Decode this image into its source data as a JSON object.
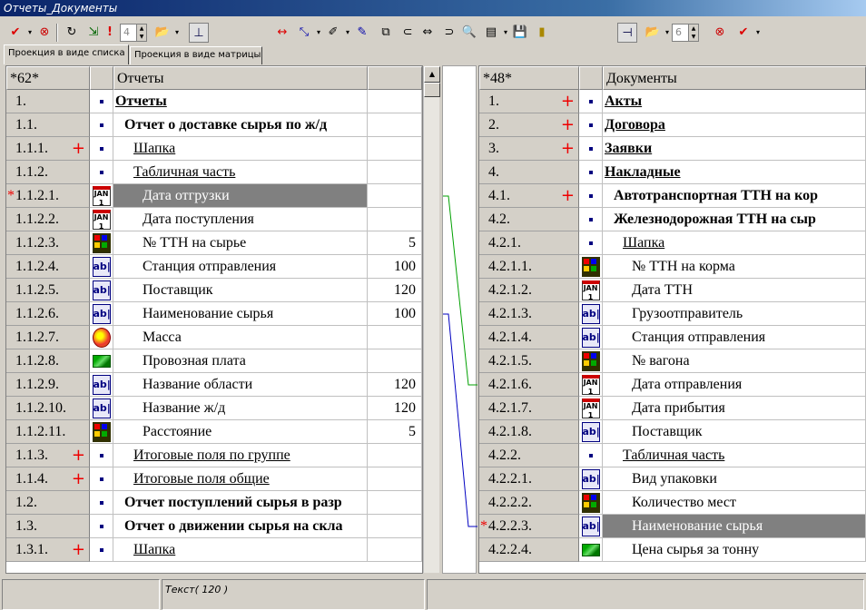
{
  "window": {
    "title": "Отчеты_Документы"
  },
  "toolbar": {
    "left_spin_value": "4",
    "right_spin_value": "6",
    "icons": [
      "check-icon",
      "cancel-icon",
      "refresh-icon",
      "add-link-icon",
      "exclamation-icon",
      "folder-open-icon",
      "tree-view-icon",
      "horizontal-arrows-icon",
      "connect-icon",
      "eraser-icon",
      "wand-icon",
      "copy-icon",
      "link-left-icon",
      "link-both-icon",
      "link-right-icon",
      "preview-icon",
      "export-icon",
      "save-icon",
      "exit-icon",
      "layout-icon"
    ]
  },
  "tabs": [
    {
      "label": "Проекция в виде списка",
      "active": true
    },
    {
      "label": "Проекция в виде матрицы",
      "active": false
    }
  ],
  "left_panel": {
    "header": {
      "num": "*62*",
      "name": "Отчеты",
      "value": ""
    },
    "rows": [
      {
        "num": "1.",
        "icon": "dot",
        "name": "Отчеты",
        "style": "bold-ul",
        "indent": 0,
        "value": "",
        "plus": false
      },
      {
        "num": "1.1.",
        "icon": "dot",
        "name": "Отчет о доставке сырья по ж/д",
        "style": "bold",
        "indent": 1,
        "value": "",
        "plus": false
      },
      {
        "num": "1.1.1.",
        "icon": "dot",
        "name": "Шапка",
        "style": "ul",
        "indent": 2,
        "value": "",
        "plus": true
      },
      {
        "num": "1.1.2.",
        "icon": "dot",
        "name": "Табличная часть",
        "style": "ul",
        "indent": 2,
        "value": "",
        "plus": false
      },
      {
        "num": "1.1.2.1.",
        "icon": "cal",
        "name": "Дата отгрузки",
        "style": "",
        "indent": 3,
        "value": "",
        "plus": false,
        "selected": true,
        "star": true
      },
      {
        "num": "1.1.2.2.",
        "icon": "cal",
        "name": "Дата поступления",
        "style": "",
        "indent": 3,
        "value": "",
        "plus": false
      },
      {
        "num": "1.1.2.3.",
        "icon": "num",
        "name": "№ ТТН на сырье",
        "style": "",
        "indent": 3,
        "value": "5",
        "plus": false
      },
      {
        "num": "1.1.2.4.",
        "icon": "ab",
        "name": "Станция отправления",
        "style": "",
        "indent": 3,
        "value": "100",
        "plus": false
      },
      {
        "num": "1.1.2.5.",
        "icon": "ab",
        "name": "Поставщик",
        "style": "",
        "indent": 3,
        "value": "120",
        "plus": false
      },
      {
        "num": "1.1.2.6.",
        "icon": "ab",
        "name": "Наименование сырья",
        "style": "",
        "indent": 3,
        "value": "100",
        "plus": false
      },
      {
        "num": "1.1.2.7.",
        "icon": "sum",
        "name": "Масса",
        "style": "",
        "indent": 3,
        "value": "",
        "plus": false
      },
      {
        "num": "1.1.2.8.",
        "icon": "money",
        "name": "Провозная плата",
        "style": "",
        "indent": 3,
        "value": "",
        "plus": false
      },
      {
        "num": "1.1.2.9.",
        "icon": "ab",
        "name": "Название области",
        "style": "",
        "indent": 3,
        "value": "120",
        "plus": false
      },
      {
        "num": "1.1.2.10.",
        "icon": "ab",
        "name": "Название ж/д",
        "style": "",
        "indent": 3,
        "value": "120",
        "plus": false
      },
      {
        "num": "1.1.2.11.",
        "icon": "num",
        "name": "Расстояние",
        "style": "",
        "indent": 3,
        "value": "5",
        "plus": false
      },
      {
        "num": "1.1.3.",
        "icon": "dot",
        "name": "Итоговые поля по группе",
        "style": "ul",
        "indent": 2,
        "value": "",
        "plus": true
      },
      {
        "num": "1.1.4.",
        "icon": "dot",
        "name": "Итоговые поля общие",
        "style": "ul",
        "indent": 2,
        "value": "",
        "plus": true
      },
      {
        "num": "1.2.",
        "icon": "dot",
        "name": "Отчет поступлений сырья в разр",
        "style": "bold",
        "indent": 1,
        "value": "",
        "plus": false
      },
      {
        "num": "1.3.",
        "icon": "dot",
        "name": "Отчет о движении сырья на скла",
        "style": "bold",
        "indent": 1,
        "value": "",
        "plus": false
      },
      {
        "num": "1.3.1.",
        "icon": "dot",
        "name": "Шапка",
        "style": "ul",
        "indent": 2,
        "value": "",
        "plus": true
      }
    ]
  },
  "right_panel": {
    "header": {
      "num": "*48*",
      "name": "Документы"
    },
    "rows": [
      {
        "num": "1.",
        "icon": "dot",
        "name": "Акты",
        "style": "bold-ul",
        "indent": 0,
        "plus": true
      },
      {
        "num": "2.",
        "icon": "dot",
        "name": "Договора",
        "style": "bold-ul",
        "indent": 0,
        "plus": true
      },
      {
        "num": "3.",
        "icon": "dot",
        "name": "Заявки",
        "style": "bold-ul",
        "indent": 0,
        "plus": true
      },
      {
        "num": "4.",
        "icon": "dot",
        "name": "Накладные",
        "style": "bold-ul",
        "indent": 0,
        "plus": false
      },
      {
        "num": "4.1.",
        "icon": "dot",
        "name": "Автотранспортная ТТН на кор",
        "style": "bold",
        "indent": 1,
        "plus": true
      },
      {
        "num": "4.2.",
        "icon": "dot",
        "name": "Железнодорожная ТТН на сыр",
        "style": "bold",
        "indent": 1,
        "plus": false
      },
      {
        "num": "4.2.1.",
        "icon": "dot",
        "name": "Шапка",
        "style": "ul",
        "indent": 2,
        "plus": false
      },
      {
        "num": "4.2.1.1.",
        "icon": "num",
        "name": "№ ТТН на корма",
        "style": "",
        "indent": 3,
        "plus": false
      },
      {
        "num": "4.2.1.2.",
        "icon": "cal",
        "name": "Дата ТТН",
        "style": "",
        "indent": 3,
        "plus": false
      },
      {
        "num": "4.2.1.3.",
        "icon": "ab",
        "name": "Грузоотправитель",
        "style": "",
        "indent": 3,
        "plus": false
      },
      {
        "num": "4.2.1.4.",
        "icon": "ab",
        "name": "Станция отправления",
        "style": "",
        "indent": 3,
        "plus": false
      },
      {
        "num": "4.2.1.5.",
        "icon": "num",
        "name": "№ вагона",
        "style": "",
        "indent": 3,
        "plus": false
      },
      {
        "num": "4.2.1.6.",
        "icon": "cal",
        "name": "Дата отправления",
        "style": "",
        "indent": 3,
        "plus": false
      },
      {
        "num": "4.2.1.7.",
        "icon": "cal",
        "name": "Дата прибытия",
        "style": "",
        "indent": 3,
        "plus": false
      },
      {
        "num": "4.2.1.8.",
        "icon": "ab",
        "name": "Поставщик",
        "style": "",
        "indent": 3,
        "plus": false
      },
      {
        "num": "4.2.2.",
        "icon": "dot",
        "name": "Табличная часть",
        "style": "ul",
        "indent": 2,
        "plus": false
      },
      {
        "num": "4.2.2.1.",
        "icon": "ab",
        "name": "Вид упаковки",
        "style": "",
        "indent": 3,
        "plus": false
      },
      {
        "num": "4.2.2.2.",
        "icon": "num",
        "name": "Количество мест",
        "style": "",
        "indent": 3,
        "plus": false
      },
      {
        "num": "4.2.2.3.",
        "icon": "ab",
        "name": "Наименование сырья",
        "style": "",
        "indent": 3,
        "plus": false,
        "selected": true,
        "star": true
      },
      {
        "num": "4.2.2.4.",
        "icon": "money",
        "name": "Цена сырья за тонну",
        "style": "",
        "indent": 3,
        "plus": false
      }
    ]
  },
  "links": [
    {
      "from_row": 4,
      "to_row": 12,
      "color": "#00a000"
    },
    {
      "from_row": 9,
      "to_row": 18,
      "color": "#0000c0"
    }
  ],
  "status": {
    "field_type": "Текст( 120 )"
  }
}
